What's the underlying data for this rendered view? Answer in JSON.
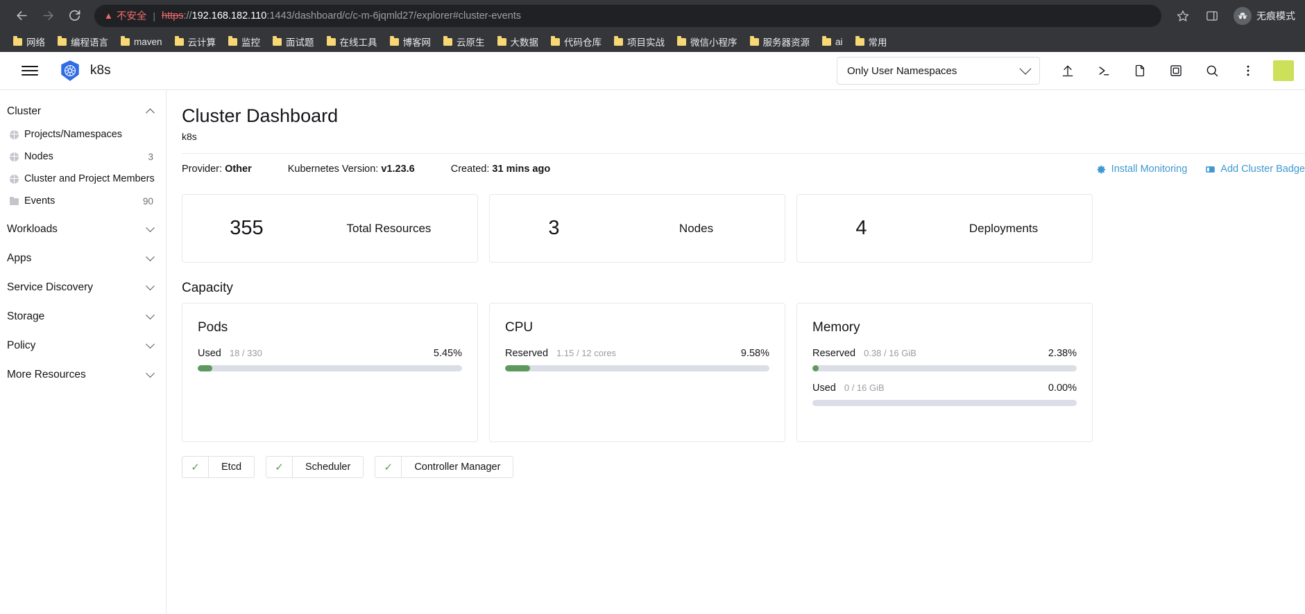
{
  "browser": {
    "nav": {
      "back_icon": "arrow-left-icon",
      "forward_icon": "arrow-right-icon",
      "reload_icon": "reload-icon"
    },
    "omnibox": {
      "warning_icon": "warning-triangle-icon",
      "insecure_label": "不安全",
      "url_scheme": "https",
      "url_scheme_sep": "://",
      "url_host": "192.168.182.110",
      "url_path": ":1443/dashboard/c/c-m-6jqmld27/explorer#cluster-events",
      "star_icon": "bookmark-star-icon",
      "sidepanel_icon": "side-panel-icon"
    },
    "incognito": {
      "label": "无痕模式",
      "icon": "incognito-hat-icon"
    },
    "bookmarks": [
      {
        "label": "网络",
        "icon": "folder-icon"
      },
      {
        "label": "编程语言",
        "icon": "folder-icon"
      },
      {
        "label": "maven",
        "icon": "folder-icon"
      },
      {
        "label": "云计算",
        "icon": "folder-icon"
      },
      {
        "label": "监控",
        "icon": "folder-icon"
      },
      {
        "label": "面试题",
        "icon": "folder-icon"
      },
      {
        "label": "在线工具",
        "icon": "folder-icon"
      },
      {
        "label": "博客网",
        "icon": "folder-icon"
      },
      {
        "label": "云原生",
        "icon": "folder-icon"
      },
      {
        "label": "大数据",
        "icon": "folder-icon"
      },
      {
        "label": "代码仓库",
        "icon": "folder-icon"
      },
      {
        "label": "项目实战",
        "icon": "folder-icon"
      },
      {
        "label": "微信小程序",
        "icon": "folder-icon"
      },
      {
        "label": "服务器资源",
        "icon": "folder-icon"
      },
      {
        "label": "ai",
        "icon": "folder-icon"
      },
      {
        "label": "常用",
        "icon": "folder-icon"
      }
    ]
  },
  "app_header": {
    "menu_icon": "hamburger-menu-icon",
    "logo_icon": "kubernetes-logo-icon",
    "brand": "k8s",
    "namespace_filter": {
      "value": "Only User Namespaces",
      "chevron_icon": "chevron-down-icon"
    },
    "icons": [
      {
        "name": "import-yaml-icon",
        "glyph": "↑"
      },
      {
        "name": "kubectl-shell-icon",
        "glyph": "≥"
      },
      {
        "name": "file-icon",
        "glyph": "⬚"
      },
      {
        "name": "cluster-picker-icon",
        "glyph": "⧉"
      },
      {
        "name": "search-icon",
        "glyph": "⌕"
      },
      {
        "name": "overflow-menu-icon",
        "glyph": "⋮"
      }
    ],
    "avatar": "user-avatar"
  },
  "sidebar": {
    "groups": [
      {
        "label": "Cluster",
        "expanded": true,
        "caret": "chevron-up-icon",
        "items": [
          {
            "label": "Projects/Namespaces",
            "count": "",
            "icon": "globe-icon"
          },
          {
            "label": "Nodes",
            "count": "3",
            "icon": "globe-icon"
          },
          {
            "label": "Cluster and Project Members",
            "count": "",
            "icon": "globe-icon"
          },
          {
            "label": "Events",
            "count": "90",
            "icon": "folder-icon"
          }
        ]
      },
      {
        "label": "Workloads",
        "expanded": false,
        "caret": "chevron-down-icon",
        "items": []
      },
      {
        "label": "Apps",
        "expanded": false,
        "caret": "chevron-down-icon",
        "items": []
      },
      {
        "label": "Service Discovery",
        "expanded": false,
        "caret": "chevron-down-icon",
        "items": []
      },
      {
        "label": "Storage",
        "expanded": false,
        "caret": "chevron-down-icon",
        "items": []
      },
      {
        "label": "Policy",
        "expanded": false,
        "caret": "chevron-down-icon",
        "items": []
      },
      {
        "label": "More Resources",
        "expanded": false,
        "caret": "chevron-down-icon",
        "items": []
      }
    ]
  },
  "main": {
    "title": "Cluster Dashboard",
    "subtitle": "k8s",
    "meta": {
      "provider_key": "Provider:",
      "provider_value": "Other",
      "version_key": "Kubernetes Version:",
      "version_value": "v1.23.6",
      "created_key": "Created:",
      "created_value": "31 mins ago"
    },
    "actions": [
      {
        "label": "Install Monitoring",
        "icon": "gear-icon"
      },
      {
        "label": "Add Cluster Badge",
        "icon": "badge-icon"
      }
    ],
    "counts": [
      {
        "value": "355",
        "label": "Total Resources"
      },
      {
        "value": "3",
        "label": "Nodes"
      },
      {
        "value": "4",
        "label": "Deployments"
      }
    ],
    "capacity_title": "Capacity",
    "capacity": [
      {
        "title": "Pods",
        "rows": [
          {
            "key": "Used",
            "fraction": "18 / 330",
            "percent": "5.45%",
            "bar": 5.45
          }
        ]
      },
      {
        "title": "CPU",
        "rows": [
          {
            "key": "Reserved",
            "fraction": "1.15 / 12 cores",
            "percent": "9.58%",
            "bar": 9.58
          }
        ]
      },
      {
        "title": "Memory",
        "rows": [
          {
            "key": "Reserved",
            "fraction": "0.38 / 16 GiB",
            "percent": "2.38%",
            "bar": 2.38
          },
          {
            "key": "Used",
            "fraction": "0 / 16 GiB",
            "percent": "0.00%",
            "bar": 0
          }
        ]
      }
    ],
    "components": [
      {
        "label": "Etcd",
        "state": "healthy",
        "icon": "check-icon"
      },
      {
        "label": "Scheduler",
        "state": "healthy",
        "icon": "check-icon"
      },
      {
        "label": "Controller Manager",
        "state": "healthy",
        "icon": "check-icon"
      }
    ]
  },
  "colors": {
    "link": "#3d98d3",
    "bar_fill": "#5d995d",
    "bar_track": "#dcdee7",
    "insecure": "#ee6c6c",
    "chrome_bg": "#35363a",
    "omnibox_bg": "#202124",
    "bookmark_folder": "#f8d775",
    "k8s_blue": "#326ce5"
  }
}
